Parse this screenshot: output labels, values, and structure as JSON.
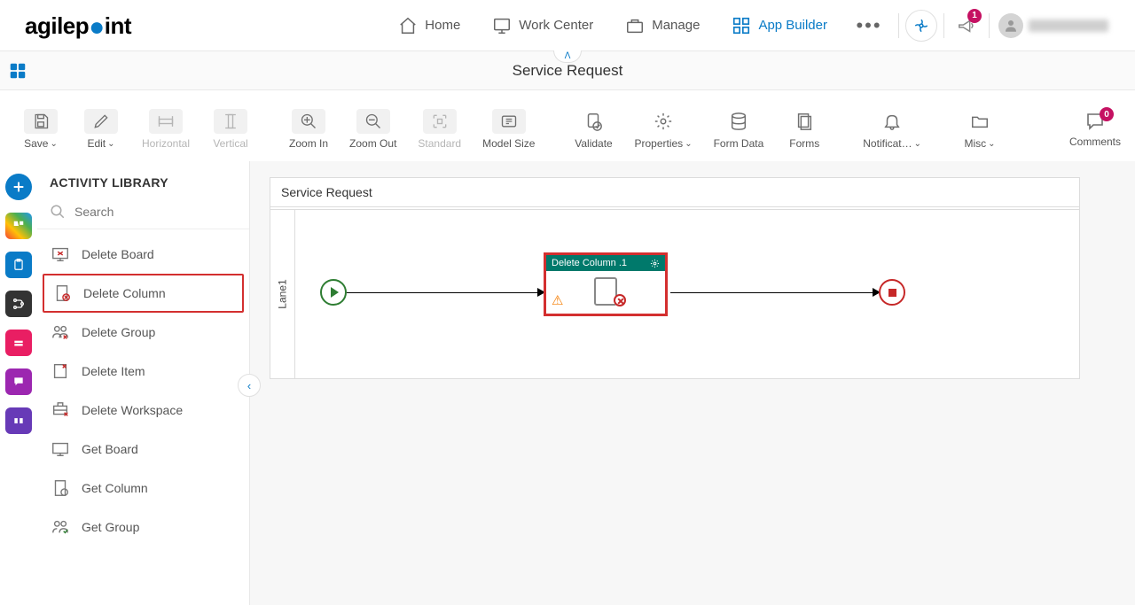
{
  "logo": {
    "text1": "agilep",
    "text2": "int"
  },
  "nav": {
    "home": "Home",
    "work_center": "Work Center",
    "manage": "Manage",
    "app_builder": "App Builder"
  },
  "notification_badge": "1",
  "page_title": "Service Request",
  "toolbar": {
    "save": "Save",
    "edit": "Edit",
    "horizontal": "Horizontal",
    "vertical": "Vertical",
    "zoom_in": "Zoom In",
    "zoom_out": "Zoom Out",
    "standard": "Standard",
    "model_size": "Model Size",
    "validate": "Validate",
    "properties": "Properties",
    "form_data": "Form Data",
    "forms": "Forms",
    "notifications": "Notificat…",
    "misc": "Misc",
    "comments": "Comments",
    "comments_badge": "0"
  },
  "sidebar": {
    "title": "ACTIVITY LIBRARY",
    "search_placeholder": "Search",
    "items": [
      "Delete Board",
      "Delete Column",
      "Delete Group",
      "Delete Item",
      "Delete Workspace",
      "Get Board",
      "Get Column",
      "Get Group"
    ]
  },
  "canvas": {
    "header": "Service Request",
    "lane": "Lane1",
    "activity_title": "Delete Column .1"
  }
}
